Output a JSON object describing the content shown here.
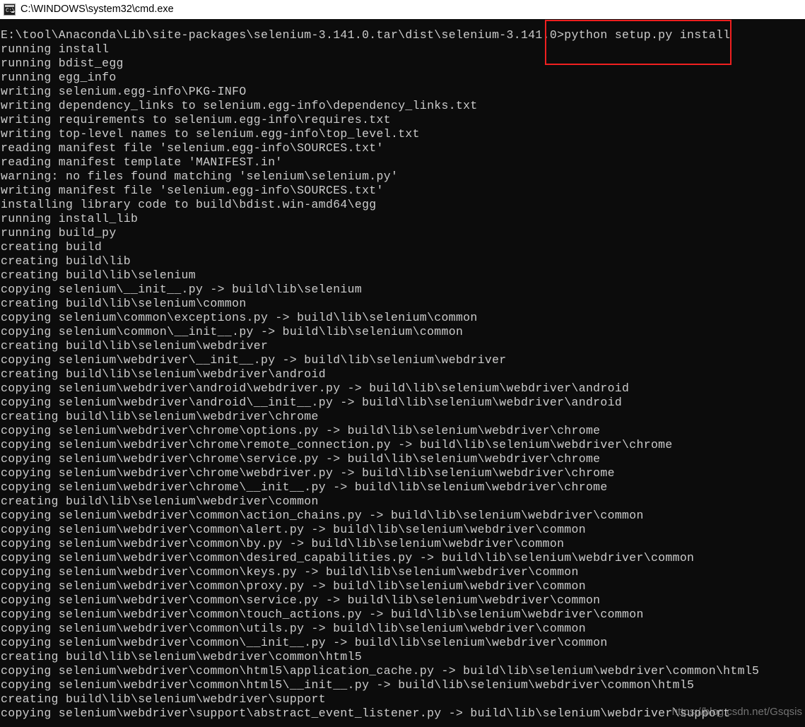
{
  "window": {
    "title": "C:\\WINDOWS\\system32\\cmd.exe",
    "icon": "cmd-icon",
    "icon_prompt_glyph": "C:\\",
    "background_color": "#0c0c0c",
    "text_color": "#cccccc",
    "titlebar_background": "#ffffff",
    "titlebar_text_color": "#000000"
  },
  "annotation": {
    "highlight_color": "#f02020",
    "highlighted_command": "python setup.py install"
  },
  "watermark": {
    "text": "https://blog.csdn.net/Gsqsis",
    "color": "#9a9a9a"
  },
  "console": {
    "prompt_path": "E:\\tool\\Anaconda\\Lib\\site-packages\\selenium-3.141.0.tar\\dist\\selenium-3.141.0",
    "prompt_symbol": ">",
    "command": "python setup.py install",
    "lines": [
      "E:\\tool\\Anaconda\\Lib\\site-packages\\selenium-3.141.0.tar\\dist\\selenium-3.141.0>python setup.py install",
      "running install",
      "running bdist_egg",
      "running egg_info",
      "writing selenium.egg-info\\PKG-INFO",
      "writing dependency_links to selenium.egg-info\\dependency_links.txt",
      "writing requirements to selenium.egg-info\\requires.txt",
      "writing top-level names to selenium.egg-info\\top_level.txt",
      "reading manifest file 'selenium.egg-info\\SOURCES.txt'",
      "reading manifest template 'MANIFEST.in'",
      "warning: no files found matching 'selenium\\selenium.py'",
      "writing manifest file 'selenium.egg-info\\SOURCES.txt'",
      "installing library code to build\\bdist.win-amd64\\egg",
      "running install_lib",
      "running build_py",
      "creating build",
      "creating build\\lib",
      "creating build\\lib\\selenium",
      "copying selenium\\__init__.py -> build\\lib\\selenium",
      "creating build\\lib\\selenium\\common",
      "copying selenium\\common\\exceptions.py -> build\\lib\\selenium\\common",
      "copying selenium\\common\\__init__.py -> build\\lib\\selenium\\common",
      "creating build\\lib\\selenium\\webdriver",
      "copying selenium\\webdriver\\__init__.py -> build\\lib\\selenium\\webdriver",
      "creating build\\lib\\selenium\\webdriver\\android",
      "copying selenium\\webdriver\\android\\webdriver.py -> build\\lib\\selenium\\webdriver\\android",
      "copying selenium\\webdriver\\android\\__init__.py -> build\\lib\\selenium\\webdriver\\android",
      "creating build\\lib\\selenium\\webdriver\\chrome",
      "copying selenium\\webdriver\\chrome\\options.py -> build\\lib\\selenium\\webdriver\\chrome",
      "copying selenium\\webdriver\\chrome\\remote_connection.py -> build\\lib\\selenium\\webdriver\\chrome",
      "copying selenium\\webdriver\\chrome\\service.py -> build\\lib\\selenium\\webdriver\\chrome",
      "copying selenium\\webdriver\\chrome\\webdriver.py -> build\\lib\\selenium\\webdriver\\chrome",
      "copying selenium\\webdriver\\chrome\\__init__.py -> build\\lib\\selenium\\webdriver\\chrome",
      "creating build\\lib\\selenium\\webdriver\\common",
      "copying selenium\\webdriver\\common\\action_chains.py -> build\\lib\\selenium\\webdriver\\common",
      "copying selenium\\webdriver\\common\\alert.py -> build\\lib\\selenium\\webdriver\\common",
      "copying selenium\\webdriver\\common\\by.py -> build\\lib\\selenium\\webdriver\\common",
      "copying selenium\\webdriver\\common\\desired_capabilities.py -> build\\lib\\selenium\\webdriver\\common",
      "copying selenium\\webdriver\\common\\keys.py -> build\\lib\\selenium\\webdriver\\common",
      "copying selenium\\webdriver\\common\\proxy.py -> build\\lib\\selenium\\webdriver\\common",
      "copying selenium\\webdriver\\common\\service.py -> build\\lib\\selenium\\webdriver\\common",
      "copying selenium\\webdriver\\common\\touch_actions.py -> build\\lib\\selenium\\webdriver\\common",
      "copying selenium\\webdriver\\common\\utils.py -> build\\lib\\selenium\\webdriver\\common",
      "copying selenium\\webdriver\\common\\__init__.py -> build\\lib\\selenium\\webdriver\\common",
      "creating build\\lib\\selenium\\webdriver\\common\\html5",
      "copying selenium\\webdriver\\common\\html5\\application_cache.py -> build\\lib\\selenium\\webdriver\\common\\html5",
      "copying selenium\\webdriver\\common\\html5\\__init__.py -> build\\lib\\selenium\\webdriver\\common\\html5",
      "creating build\\lib\\selenium\\webdriver\\support",
      "copying selenium\\webdriver\\support\\abstract_event_listener.py -> build\\lib\\selenium\\webdriver\\support"
    ]
  }
}
